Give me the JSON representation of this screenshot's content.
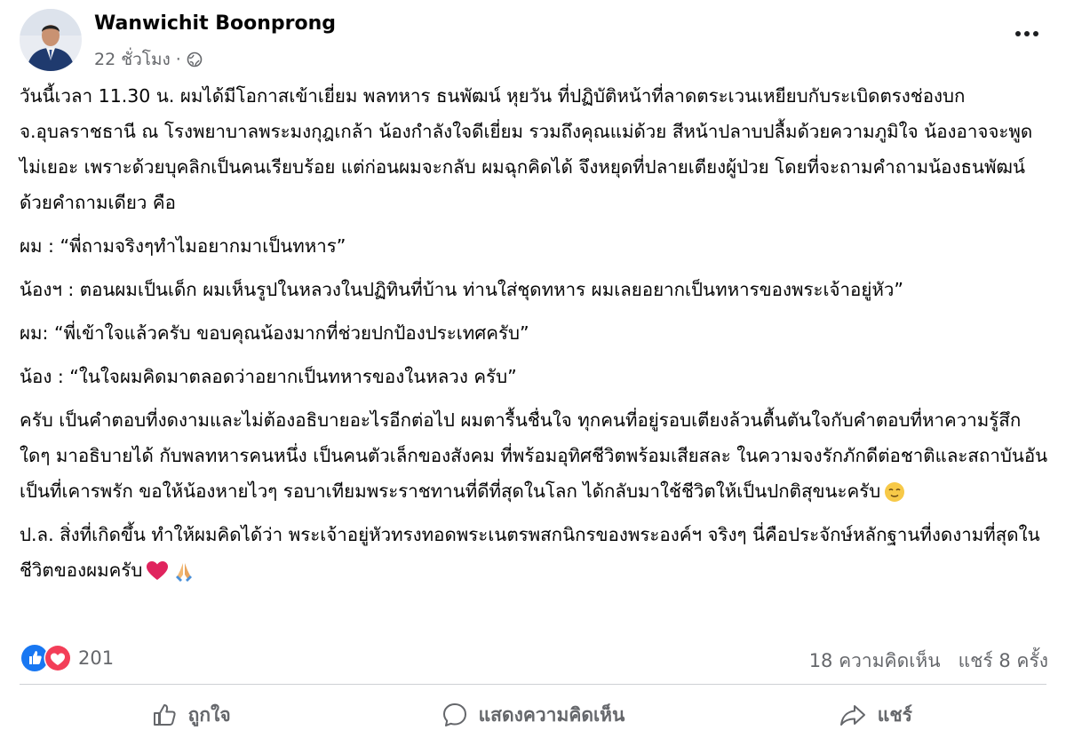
{
  "post": {
    "author": "Wanwichit Boonprong",
    "time": "22 ชั่วโมง",
    "separator": "·",
    "paragraphs": [
      "วันนี้เวลา 11.30 น. ผมได้มีโอกาสเข้าเยี่ยม  พลทหาร ธนพัฒน์ หุยวัน ที่ปฏิบัติหน้าที่ลาดตระเวนเหยียบกับระเบิดตรงช่องบก จ.อุบลราชธานี ณ โรงพยาบาลพระมงกุฎเกล้า น้องกำลังใจดีเยี่ยม รวมถึงคุณแม่ด้วย สีหน้าปลาบปลื้มด้วยความภูมิใจ น้องอาจจะพูดไม่เยอะ เพราะด้วยบุคลิกเป็นคนเรียบร้อย แต่ก่อนผมจะกลับ ผมฉุกคิดได้ จึงหยุดที่ปลายเตียงผู้ป่วย โดยที่จะถามคำถามน้องธนพัฒน์ ด้วยคำถามเดียว คือ",
      "ผม : “พี่ถามจริงๆทำไมอยากมาเป็นทหาร”",
      "น้องฯ : ตอนผมเป็นเด็ก ผมเห็นรูปในหลวงในปฏิทินที่บ้าน ท่านใส่ชุดทหาร ผมเลยอยากเป็นทหารของพระเจ้าอยู่หัว”",
      "ผม:  “พี่เข้าใจแล้วครับ ขอบคุณน้องมากที่ช่วยปกป้องประเทศครับ”",
      "น้อง : “ในใจผมคิดมาตลอดว่าอยากเป็นทหารของในหลวง ครับ”",
      "ครับ เป็นคำตอบที่งดงามและไม่ต้องอธิบายอะไรอีกต่อไป ผมตารื้นชื่นใจ ทุกคนที่อยู่รอบเตียงล้วนตื้นตันใจกับคำตอบที่หาความรู้สึกใดๆ มาอธิบายได้  กับพลทหารคนหนึ่ง เป็นคนตัวเล็กของสังคม ที่พร้อมอุทิศชีวิตพร้อมเสียสละ ในความจงรักภักดีต่อชาติและสถาบันอันเป็นที่เคารพรัก  ขอให้น้องหายไวๆ รอบาเทียมพระราชทานที่ดีที่สุดในโลก ได้กลับมาใช้ชีวิตให้เป็นปกติสุขนะครับ",
      "ป.ล. สิ่งที่เกิดขึ้น ทำให้ผมคิดได้ว่า พระเจ้าอยู่หัวทรงทอดพระเนตรพสกนิกรของพระองค์ฯ จริงๆ นี่คือประจักษ์หลักฐานที่งดงามที่สุดในชีวิตของผมครับ"
    ],
    "reactions_count": "201",
    "comments": "18 ความคิดเห็น",
    "shares": "แชร์ 8 ครั้ง",
    "actions": {
      "like": "ถูกใจ",
      "comment": "แสดงความคิดเห็น",
      "share": "แชร์"
    }
  },
  "icons": {
    "globe": "globe-icon",
    "more": "more-options-icon",
    "like_reaction": "like-reaction-icon",
    "love_reaction": "love-reaction-icon",
    "like_action": "thumbs-up-icon",
    "comment_action": "comment-bubble-icon",
    "share_action": "share-arrow-icon"
  },
  "colors": {
    "like_blue": "#1877f2",
    "love_red": "#f33e58",
    "secondary_text": "#65676b"
  }
}
